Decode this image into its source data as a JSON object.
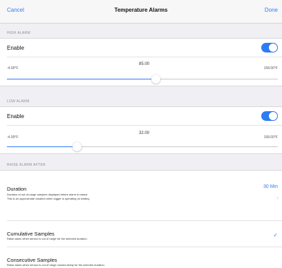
{
  "navbar": {
    "cancel": "Cancel",
    "title": "Temperature Alarms",
    "done": "Done"
  },
  "high_alarm": {
    "header": "HIGH ALARM",
    "enable_label": "Enable",
    "enabled": true,
    "min_label": "-4.00°F",
    "max_label": "158.00°F",
    "value": "85.00",
    "slider_fraction": 0.55
  },
  "low_alarm": {
    "header": "LOW ALARM",
    "enable_label": "Enable",
    "enabled": true,
    "min_label": "-4.00°F",
    "max_label": "158.00°F",
    "value": "32.00",
    "slider_fraction": 0.26
  },
  "raise_alarm": {
    "header": "RAISE ALARM AFTER",
    "duration": {
      "title": "Duration",
      "subtitle_1": "Duration of out-of-range samples displayed before alarm is raised.",
      "subtitle_2": "This is an approximate duration when logger is operating on battery.",
      "value": "30 Min"
    },
    "cumulative": {
      "title": "Cumulative Samples",
      "subtitle": "Raise alarm when sensor is out of range for the selected duration.",
      "selected": true
    },
    "consecutive": {
      "title": "Consecutive Samples",
      "subtitle": "Raise alarm when sensor is out of range consecutively for the selected duration."
    }
  },
  "colors": {
    "accent": "#3478f6",
    "toggle_on": "#2c7cf5",
    "background": "#efeff4"
  }
}
